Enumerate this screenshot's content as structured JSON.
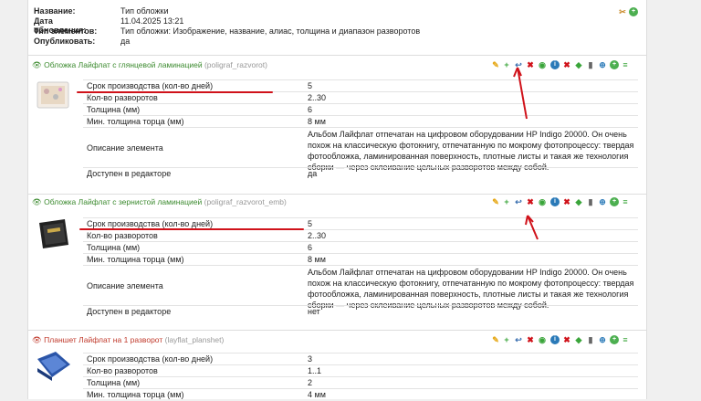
{
  "header": {
    "rows": [
      {
        "label": "Название:",
        "value": "Тип обложки"
      },
      {
        "label": "Дата обновления:",
        "value": "11.04.2025 13:21"
      },
      {
        "label": "Тип элементов:",
        "value": "Тип обложки: Изображение, название, алиас, толщина и диапазон разворотов"
      },
      {
        "label": "Опубликовать:",
        "value": "да"
      }
    ]
  },
  "items": [
    {
      "name": "Обложка Лайфлат с глянцевой ламинацией",
      "alias": "(poligraf_razvorot)",
      "props": [
        {
          "k": "Срок производства (кол-во дней)",
          "v": "5"
        },
        {
          "k": "Кол-во разворотов",
          "v": "2..30"
        },
        {
          "k": "Толщина (мм)",
          "v": "6"
        },
        {
          "k": "Мин. толщина торца (мм)",
          "v": "8 мм"
        },
        {
          "k": "Описание элемента",
          "v": "Альбом Лайфлат отпечатан на цифровом оборудовании HP Indigo 20000. Он очень похож на классическую фотокнигу, отпечатанную по мокрому фотопроцессу: твердая фотообложка, ламинированная поверхность, плотные листы и такая же технология сборки — через склеивание цельных разворотов между собой."
        },
        {
          "k": "Доступен в редакторе",
          "v": "да"
        }
      ]
    },
    {
      "name": "Обложка Лайфлат с зернистой ламинацией",
      "alias": "(poligraf_razvorot_emb)",
      "props": [
        {
          "k": "Срок производства (кол-во дней)",
          "v": "5"
        },
        {
          "k": "Кол-во разворотов",
          "v": "2..30"
        },
        {
          "k": "Толщина (мм)",
          "v": "6"
        },
        {
          "k": "Мин. толщина торца (мм)",
          "v": "8 мм"
        },
        {
          "k": "Описание элемента",
          "v": "Альбом Лайфлат отпечатан на цифровом оборудовании HP Indigo 20000. Он очень похож на классическую фотокнигу, отпечатанную по мокрому фотопроцессу: твердая фотообложка, ламинированная поверхность, плотные листы и такая же технология сборки — через склеивание цельных разворотов между собой."
        },
        {
          "k": "Доступен в редакторе",
          "v": "нет"
        }
      ]
    },
    {
      "name": "Планшет Лайфлат на 1 разворот",
      "alias": "(layflat_planshet)",
      "props": [
        {
          "k": "Срок производства (кол-во дней)",
          "v": "3"
        },
        {
          "k": "Кол-во разворотов",
          "v": "1..1"
        },
        {
          "k": "Толщина (мм)",
          "v": "2"
        },
        {
          "k": "Мин. толщина торца (мм)",
          "v": "4 мм"
        }
      ]
    }
  ],
  "icons": [
    "edit-icon",
    "add-icon",
    "move-icon",
    "delete-icon",
    "view-icon",
    "info-icon",
    "remove-icon",
    "tag-icon",
    "lock-icon",
    "link-icon",
    "add-circle-icon",
    "list-icon"
  ],
  "colors": {
    "accent_green": "#3b8a2e",
    "alert_red": "#d0121a",
    "info_blue": "#2a7ab8"
  }
}
